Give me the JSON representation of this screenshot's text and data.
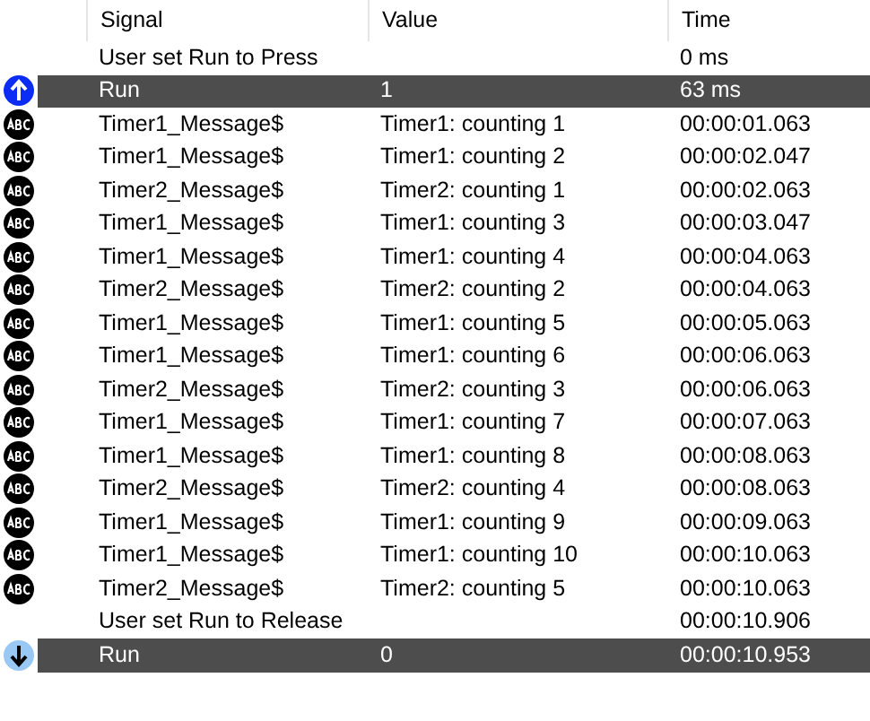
{
  "table": {
    "columns": [
      "Signal",
      "Value",
      "Time"
    ],
    "rows": [
      {
        "kind": "event",
        "selected": false,
        "signal": "User set Run to Press",
        "value": "",
        "time": "0 ms"
      },
      {
        "kind": "rise",
        "selected": true,
        "signal": "Run",
        "value": "1",
        "time": "63 ms"
      },
      {
        "kind": "text",
        "selected": false,
        "signal": "Timer1_Message$",
        "value": "Timer1: counting 1",
        "time": "00:00:01.063"
      },
      {
        "kind": "text",
        "selected": false,
        "signal": "Timer1_Message$",
        "value": "Timer1: counting 2",
        "time": "00:00:02.047"
      },
      {
        "kind": "text",
        "selected": false,
        "signal": "Timer2_Message$",
        "value": "Timer2: counting 1",
        "time": "00:00:02.063"
      },
      {
        "kind": "text",
        "selected": false,
        "signal": "Timer1_Message$",
        "value": "Timer1: counting 3",
        "time": "00:00:03.047"
      },
      {
        "kind": "text",
        "selected": false,
        "signal": "Timer1_Message$",
        "value": "Timer1: counting 4",
        "time": "00:00:04.063"
      },
      {
        "kind": "text",
        "selected": false,
        "signal": "Timer2_Message$",
        "value": "Timer2: counting 2",
        "time": "00:00:04.063"
      },
      {
        "kind": "text",
        "selected": false,
        "signal": "Timer1_Message$",
        "value": "Timer1: counting 5",
        "time": "00:00:05.063"
      },
      {
        "kind": "text",
        "selected": false,
        "signal": "Timer1_Message$",
        "value": "Timer1: counting 6",
        "time": "00:00:06.063"
      },
      {
        "kind": "text",
        "selected": false,
        "signal": "Timer2_Message$",
        "value": "Timer2: counting 3",
        "time": "00:00:06.063"
      },
      {
        "kind": "text",
        "selected": false,
        "signal": "Timer1_Message$",
        "value": "Timer1: counting 7",
        "time": "00:00:07.063"
      },
      {
        "kind": "text",
        "selected": false,
        "signal": "Timer1_Message$",
        "value": "Timer1: counting 8",
        "time": "00:00:08.063"
      },
      {
        "kind": "text",
        "selected": false,
        "signal": "Timer2_Message$",
        "value": "Timer2: counting 4",
        "time": "00:00:08.063"
      },
      {
        "kind": "text",
        "selected": false,
        "signal": "Timer1_Message$",
        "value": "Timer1: counting 9",
        "time": "00:00:09.063"
      },
      {
        "kind": "text",
        "selected": false,
        "signal": "Timer1_Message$",
        "value": "Timer1: counting 10",
        "time": "00:00:10.063"
      },
      {
        "kind": "text",
        "selected": false,
        "signal": "Timer2_Message$",
        "value": "Timer2: counting 5",
        "time": "00:00:10.063"
      },
      {
        "kind": "event",
        "selected": false,
        "signal": "User set Run to Release",
        "value": "",
        "time": "00:00:10.906"
      },
      {
        "kind": "fall",
        "selected": true,
        "signal": "Run",
        "value": "0",
        "time": "00:00:10.953"
      }
    ]
  }
}
